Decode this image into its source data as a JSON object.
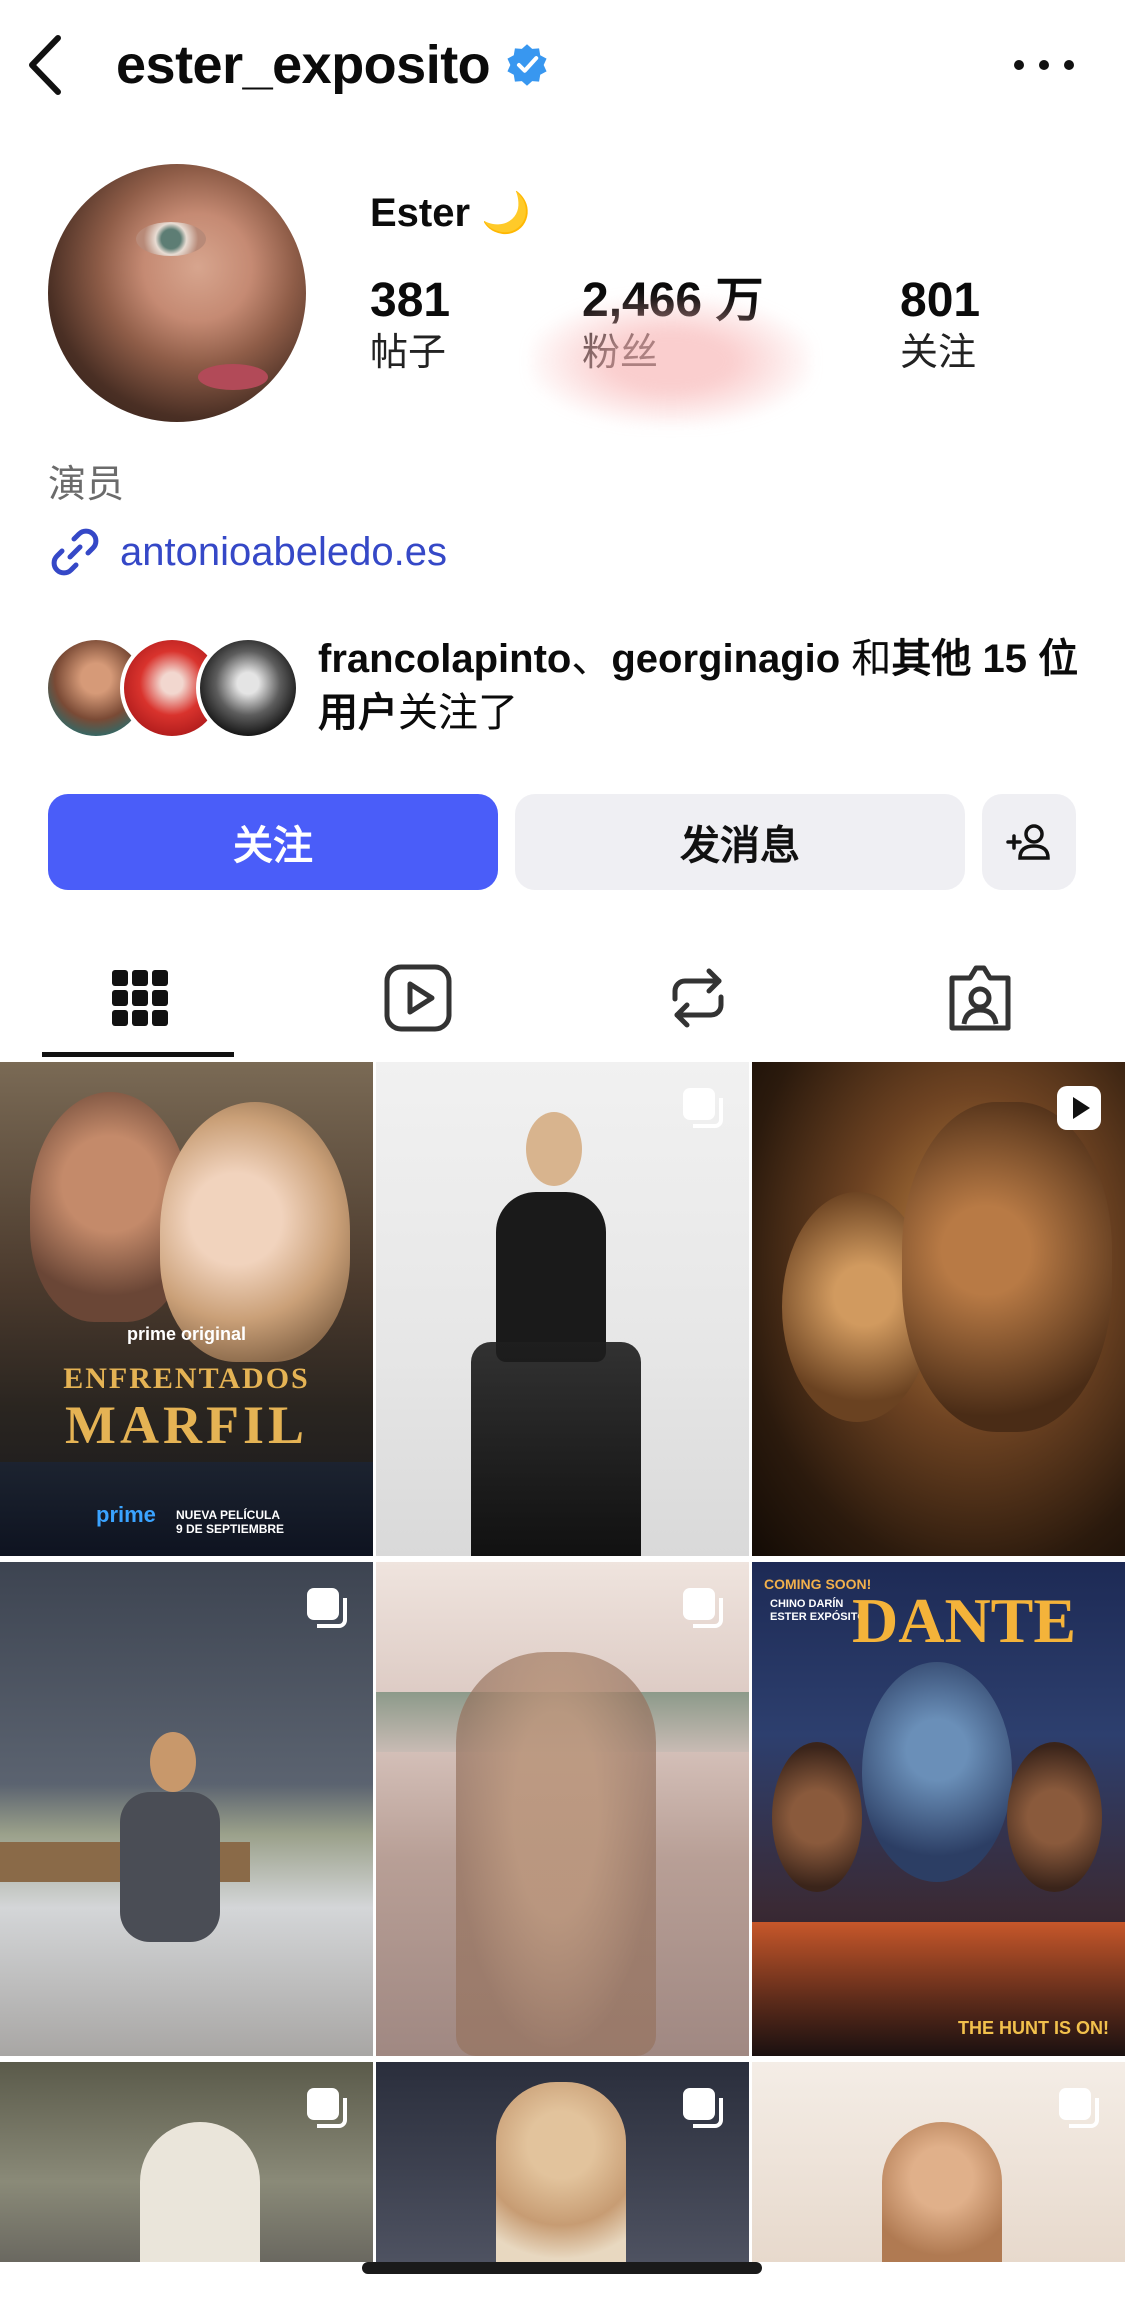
{
  "header": {
    "username": "ester_exposito",
    "verified": true
  },
  "profile": {
    "display_name": "Ester 🌙",
    "stats": [
      {
        "value": "381",
        "label": "帖子"
      },
      {
        "value": "2,466 万",
        "label": "粉丝"
      },
      {
        "value": "801",
        "label": "关注"
      }
    ],
    "category": "演员",
    "link": "antonioabeledo.es",
    "mutual": {
      "name1": "francolapinto",
      "sep": "、",
      "name2": "georginagio",
      "and": " 和",
      "others": "其他 15 位用户",
      "suffix": "关注了"
    }
  },
  "actions": {
    "follow": "关注",
    "message": "发消息"
  },
  "tabs": [
    "posts",
    "reels",
    "reposts",
    "tagged"
  ],
  "grid": {
    "posts": [
      {
        "type": "poster",
        "top_text": "prime original",
        "title1": "ENFRENTADOS",
        "title2": "MARFIL",
        "bottom_left": "prime",
        "bottom_right": "NUEVA PELÍCULA\n9 DE SEPTIEMBRE"
      },
      {
        "type": "carousel"
      },
      {
        "type": "reel"
      },
      {
        "type": "carousel"
      },
      {
        "type": "carousel"
      },
      {
        "type": "poster",
        "top_text": "COMING SOON!",
        "credits": "CHINO DARÍN\nESTER EXPÓSITO",
        "title1": "DANTE",
        "bottom_right": "THE HUNT IS ON!"
      },
      {
        "type": "carousel"
      },
      {
        "type": "carousel"
      },
      {
        "type": "carousel"
      }
    ]
  },
  "colors": {
    "primary": "#4a5df9",
    "link": "#3548c7",
    "secondary_button": "#efeff3",
    "verified": "#3897f0"
  }
}
